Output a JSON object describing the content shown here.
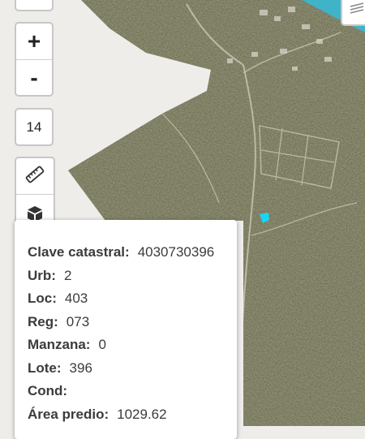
{
  "map": {
    "zoom_in_label": "+",
    "zoom_out_label": "-",
    "zoom_level": "14",
    "parcel_color": "#19d6f5",
    "water_color": "#3fb3c8",
    "unmapped_area_color": "#efedea",
    "imagery_color": "#6b6a4d"
  },
  "controls": {
    "search_icon": "search-icon",
    "measure_icon": "ruler-icon",
    "layers_3d_icon": "cube-icon",
    "basemap_icon": "layers-icon"
  },
  "popup": {
    "fields": [
      {
        "key": "Clave catastral:",
        "value": "4030730396"
      },
      {
        "key": "Urb:",
        "value": "2"
      },
      {
        "key": "Loc:",
        "value": "403"
      },
      {
        "key": "Reg:",
        "value": "073"
      },
      {
        "key": "Manzana:",
        "value": "0"
      },
      {
        "key": "Lote:",
        "value": "396"
      },
      {
        "key": "Cond:",
        "value": ""
      },
      {
        "key": "Área predio:",
        "value": "1029.62"
      }
    ]
  }
}
